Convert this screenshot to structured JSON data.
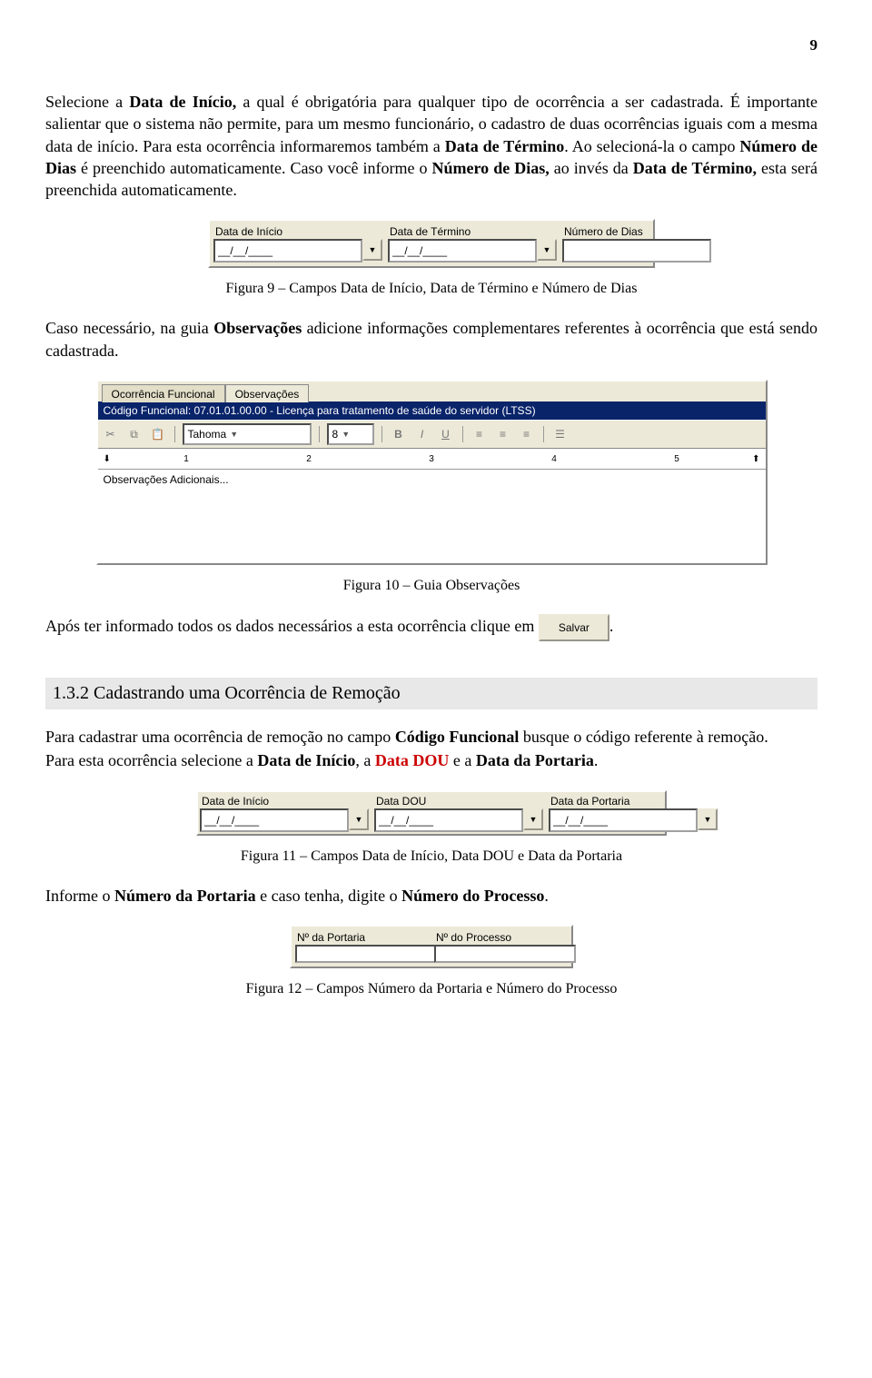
{
  "page_number": "9",
  "para1_html": "Selecione a <b>Data de Início,</b> a qual é obrigatória para qualquer tipo de ocorrência a ser cadastrada. É importante salientar que o sistema não permite, para um mesmo funcionário, o cadastro de duas ocorrências iguais com a mesma data de início. Para esta ocorrência informaremos também a <b>Data de Término</b>. Ao selecioná-la o campo <b>Número de Dias</b> é preenchido automaticamente. Caso você informe o <b>Número de Dias,</b> ao invés da <b>Data de Término,</b> esta será preenchida automaticamente.",
  "fig9": {
    "f1_label": "Data de Início",
    "f2_label": "Data de Término",
    "f3_label": "Número de Dias",
    "date_placeholder": "__/__/____"
  },
  "fig9_caption": "Figura 9 – Campos Data de Início, Data de Término e Número de Dias",
  "para2_html": "Caso necessário, na guia <b>Observações</b> adicione informações complementares referentes à ocorrência que está sendo cadastrada.",
  "fig10": {
    "tab1": "Ocorrência Funcional",
    "tab2": "Observações",
    "codigo_line": "Código Funcional: 07.01.01.00.00 - Licença para tratamento de saúde do servidor (LTSS)",
    "font": "Tahoma",
    "size": "8",
    "ruler_nums": [
      "1",
      "2",
      "3",
      "4",
      "5"
    ],
    "placeholder": "Observações Adicionais..."
  },
  "fig10_caption": "Figura 10 – Guia Observações",
  "para_save_prefix": "Após ter informado todos os dados necessários a esta ocorrência clique em ",
  "save_button": "Salvar",
  "section_132": "1.3.2  Cadastrando uma Ocorrência de Remoção",
  "para3_html": "Para cadastrar uma ocorrência de remoção no campo <b>Código Funcional</b> busque o código referente à remoção.",
  "para4_html": "Para esta ocorrência selecione a <b>Data de Início</b>, a <b class='red'>Data DOU</b> e a <b>Data da Portaria</b>.",
  "fig11": {
    "f1_label": "Data de Início",
    "f2_label": "Data DOU",
    "f3_label": "Data da Portaria",
    "date_placeholder": "__/__/____"
  },
  "fig11_caption": "Figura 11 – Campos Data de Início, Data DOU e Data da Portaria",
  "para5_html": "Informe o <b>Número da Portaria</b> e caso tenha, digite o <b>Número do Processo</b>.",
  "fig12": {
    "f1_label": "Nº da Portaria",
    "f2_label": "Nº do Processo"
  },
  "fig12_caption": "Figura 12 – Campos Número da Portaria e Número do Processo"
}
